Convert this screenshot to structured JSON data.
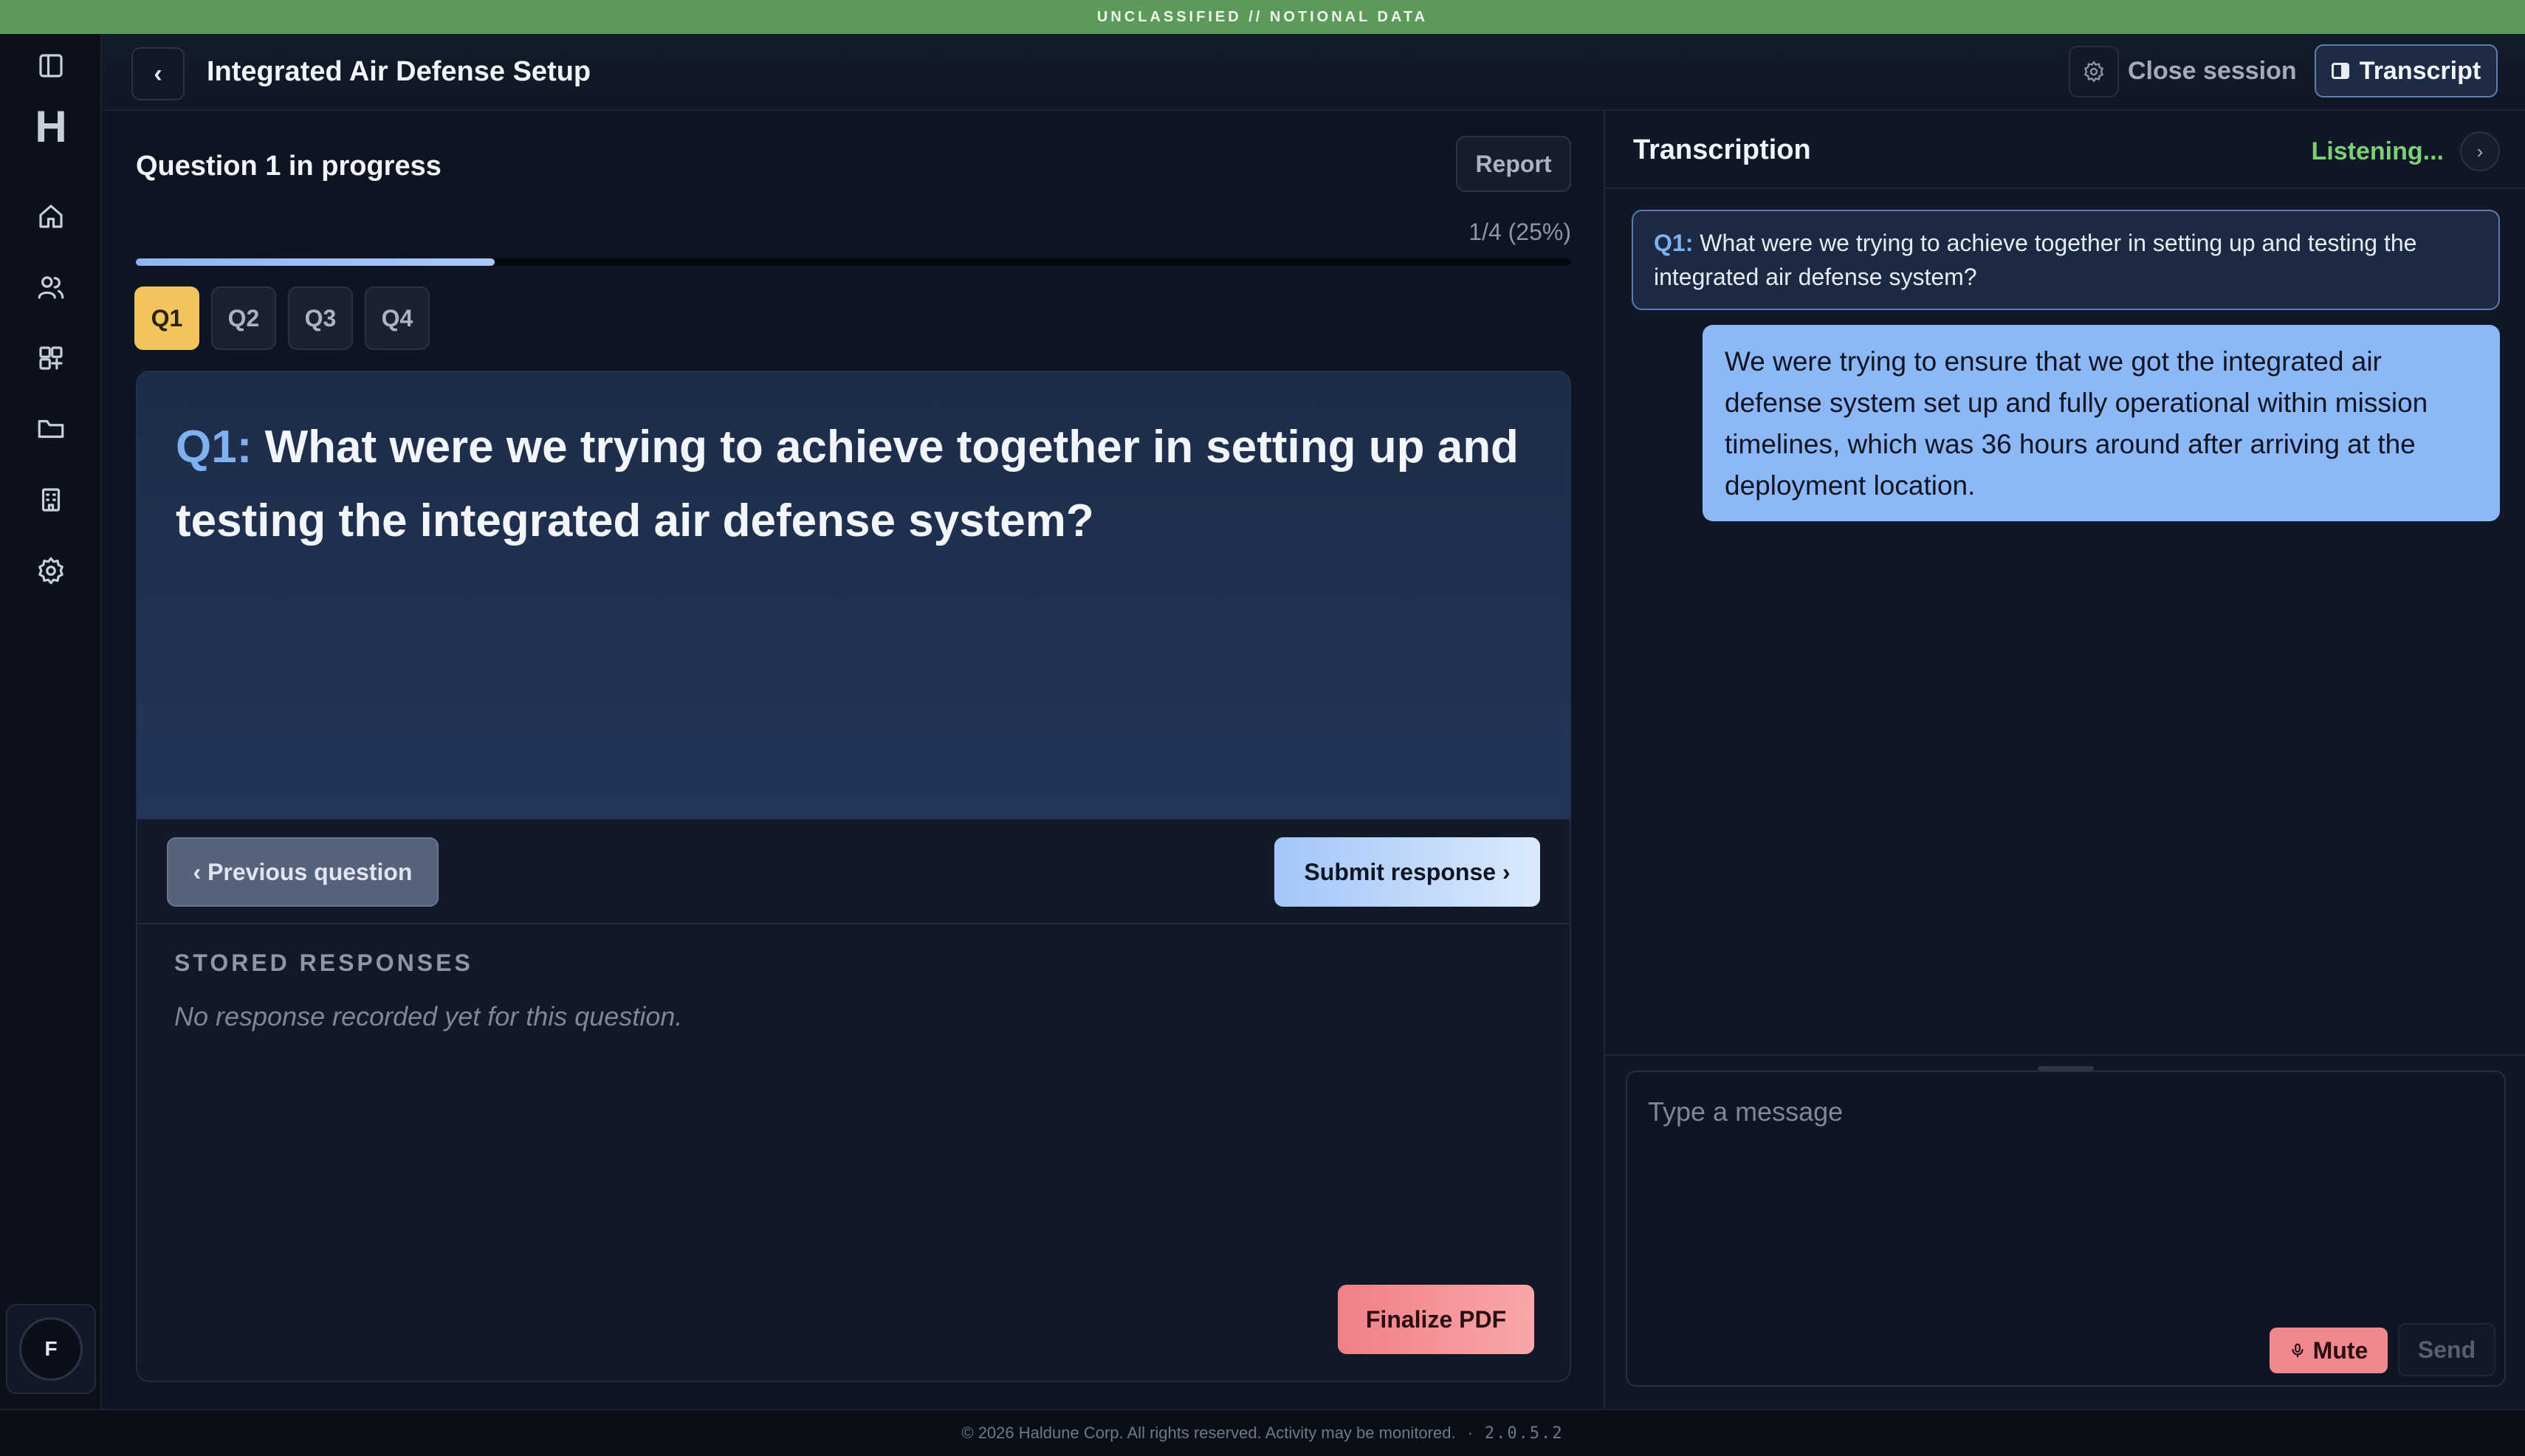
{
  "classification_banner": "UNCLASSIFIED // NOTIONAL DATA",
  "sidebar": {
    "logo": "H",
    "icons": [
      "panel-toggle-icon",
      "home-icon",
      "users-icon",
      "modules-icon",
      "folder-icon",
      "building-icon",
      "settings-icon"
    ],
    "avatar_initial": "F"
  },
  "header": {
    "back_label": "‹",
    "title": "Integrated Air Defense Setup",
    "close_session_label": "Close session",
    "transcript_label": "Transcript"
  },
  "question_panel": {
    "status_title": "Question 1 in progress",
    "report_label": "Report",
    "progress_text": "1/4 (25%)",
    "progress_fraction": 0.25,
    "tabs": [
      {
        "label": "Q1",
        "active": true
      },
      {
        "label": "Q2",
        "active": false
      },
      {
        "label": "Q3",
        "active": false
      },
      {
        "label": "Q4",
        "active": false
      }
    ],
    "question_number": "Q1:",
    "question_text": "What were we trying to achieve together in setting up and testing the integrated air defense system?",
    "previous_label": "‹ Previous question",
    "submit_label": "Submit response ›",
    "stored_title": "STORED RESPONSES",
    "stored_empty": "No response recorded yet for this question.",
    "finalize_label": "Finalize PDF"
  },
  "transcription": {
    "title": "Transcription",
    "status": "Listening...",
    "chevron": "›",
    "question_bubble_number": "Q1:",
    "question_bubble_text": "What were we trying to achieve together in setting up and testing the integrated air defense system?",
    "answer_text": "We were trying to ensure that we got the integrated air defense system set up and fully operational within mission timelines, which was 36 hours around after arriving at the deployment location.",
    "input_placeholder": "Type a message",
    "mute_label": "Mute",
    "send_label": "Send"
  },
  "footer": {
    "copyright": "© 2026 Haldune Corp. All rights reserved. Activity may be monitored.",
    "separator": "·",
    "version": "2.0.5.2"
  },
  "colors": {
    "banner": "#5c9a5c",
    "accent_blue": "#8db8f7",
    "active_tab": "#f1c55c",
    "listening": "#7ccf74",
    "danger": "#f08890"
  }
}
